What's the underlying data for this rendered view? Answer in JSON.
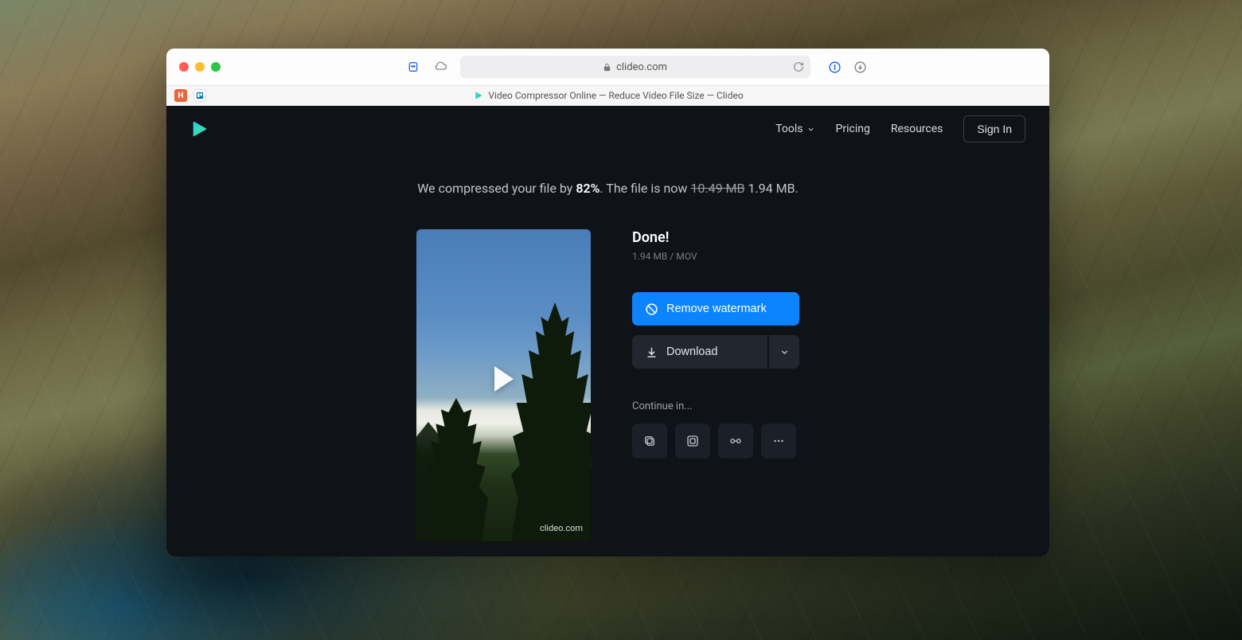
{
  "browser": {
    "address": "clideo.com",
    "tab_title": "Video Compressor Online — Reduce Video File Size — Clideo"
  },
  "nav": {
    "tools": "Tools",
    "pricing": "Pricing",
    "resources": "Resources",
    "signin": "Sign In"
  },
  "summary": {
    "prefix": "We compressed your file by ",
    "percent": "82%",
    "middle": ". The file is now ",
    "old_size": "10.49 MB",
    "new_size": "1.94 MB",
    "suffix": "."
  },
  "result": {
    "title": "Done!",
    "size": "1.94 MB",
    "sep": "  /  ",
    "format": "MOV",
    "watermark_label": "clideo.com"
  },
  "buttons": {
    "remove_watermark": "Remove watermark",
    "download": "Download"
  },
  "continue": {
    "label": "Continue in..."
  }
}
